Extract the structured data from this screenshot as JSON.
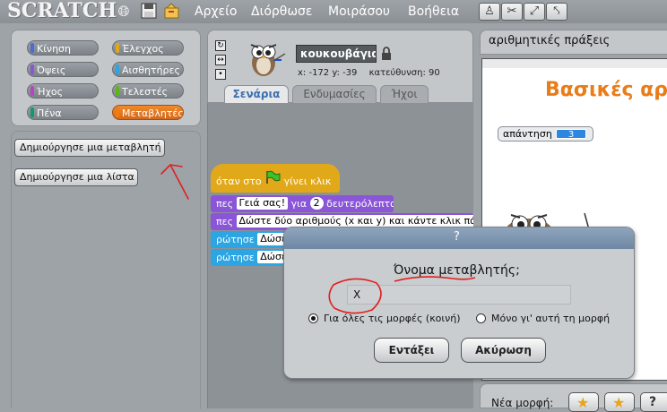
{
  "app": {
    "logo": "SCRATCH",
    "menu": [
      "Αρχείο",
      "Διόρθωσε",
      "Μοιράσου",
      "Βοήθεια"
    ]
  },
  "palette": {
    "categories": [
      {
        "label": "Κίνηση",
        "color": "#4a6cd4"
      },
      {
        "label": "Έλεγχος",
        "color": "#e1a91a"
      },
      {
        "label": "Όψεις",
        "color": "#8a55d7"
      },
      {
        "label": "Αισθητήρες",
        "color": "#2ca5e2"
      },
      {
        "label": "Ήχος",
        "color": "#bb42c3"
      },
      {
        "label": "Τελεστές",
        "color": "#5cb712"
      },
      {
        "label": "Πένα",
        "color": "#0e9a6c"
      },
      {
        "label": "Μεταβλητές",
        "color": "#ee7d16"
      }
    ],
    "buttons": {
      "make_variable": "Δημιούργησε μια μεταβλητή",
      "make_list": "Δημιούργησε μια λίστα"
    }
  },
  "sprite": {
    "name": "κουκουβάγια",
    "coords": "x: -172  y: -39",
    "direction": "κατεύθυνση: 90"
  },
  "tabs": [
    "Σενάρια",
    "Ενδυμασίες",
    "Ήχοι"
  ],
  "script": {
    "hat_prefix": "όταν στο",
    "hat_suffix": "γίνει κλικ",
    "say1_prefix": "πες",
    "say1_text": "Γειά σας!",
    "say1_for": "για",
    "say1_secs": "2",
    "say1_suffix": "δευτερόλεπτα",
    "say2_prefix": "πες",
    "say2_text": "Δώστε δύο αριθμούς (x και y) και κάντε κλικ πά",
    "ask1_prefix": "ρώτησε",
    "ask1_text": "Δώσε",
    "ask2_prefix": "ρώτησε",
    "ask2_text": "Δώσε"
  },
  "stage": {
    "title": "αριθμητικές πράξεις",
    "heading": "Βασικές αρι",
    "monitor_label": "απάντηση",
    "monitor_value": "3",
    "new_sprite_label": "Νέα μορφή:"
  },
  "dialog": {
    "title": "?",
    "label": "Όνομα μεταβλητής;",
    "input_value": "X",
    "radio_all": "Για όλες τις μορφές (κοινή)",
    "radio_this": "Μόνο γι' αυτή τη μορφή",
    "ok": "Εντάξει",
    "cancel": "Ακύρωση"
  },
  "colors": {
    "motion": "#4a6cd4",
    "looks": "#8a55d7",
    "sensing": "#2ca5e2",
    "control": "#e1a91a",
    "orange": "#ee7d16",
    "annotation": "#e02020"
  }
}
